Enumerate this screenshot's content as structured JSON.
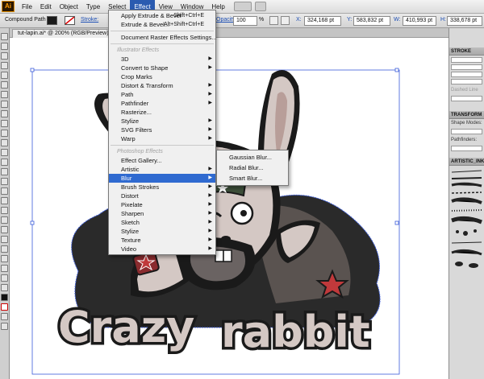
{
  "app": {
    "logo": "Ai"
  },
  "menubar": {
    "items": [
      "File",
      "Edit",
      "Object",
      "Type",
      "Select",
      "Effect",
      "View",
      "Window",
      "Help"
    ],
    "active": "Effect"
  },
  "controlbar": {
    "path_label": "Compound Path",
    "stroke_label": "Stroke:",
    "opacity_label": "Opacity:",
    "opacity_value": "100",
    "opacity_unit": "%",
    "x_label": "X:",
    "x_value": "324,168 pt",
    "y_label": "Y:",
    "y_value": "583,832 pt",
    "w_label": "W:",
    "w_value": "410,993 pt",
    "h_label": "H:",
    "h_value": "338,678 pt"
  },
  "document": {
    "tab_title": "tut-lapin.ai* @ 200% (RGB/Preview)",
    "close_glyph": "×"
  },
  "effect_menu": {
    "top_items": [
      {
        "label": "Apply Extrude & Bevel",
        "shortcut": "Shift+Ctrl+E"
      },
      {
        "label": "Extrude & Bevel...",
        "shortcut": "Alt+Shift+Ctrl+E"
      }
    ],
    "document_raster": "Document Raster Effects Settings...",
    "illustrator_header": "Illustrator Effects",
    "illustrator_items": [
      {
        "label": "3D",
        "submenu": true
      },
      {
        "label": "Convert to Shape",
        "submenu": true
      },
      {
        "label": "Crop Marks",
        "submenu": false
      },
      {
        "label": "Distort & Transform",
        "submenu": true
      },
      {
        "label": "Path",
        "submenu": true
      },
      {
        "label": "Pathfinder",
        "submenu": true
      },
      {
        "label": "Rasterize...",
        "submenu": false
      },
      {
        "label": "Stylize",
        "submenu": true
      },
      {
        "label": "SVG Filters",
        "submenu": true
      },
      {
        "label": "Warp",
        "submenu": true
      }
    ],
    "photoshop_header": "Photoshop Effects",
    "photoshop_items": [
      {
        "label": "Effect Gallery...",
        "submenu": false
      },
      {
        "label": "Artistic",
        "submenu": true
      },
      {
        "label": "Blur",
        "submenu": true,
        "highlighted": true
      },
      {
        "label": "Brush Strokes",
        "submenu": true
      },
      {
        "label": "Distort",
        "submenu": true
      },
      {
        "label": "Pixelate",
        "submenu": true
      },
      {
        "label": "Sharpen",
        "submenu": true
      },
      {
        "label": "Sketch",
        "submenu": true
      },
      {
        "label": "Stylize",
        "submenu": true
      },
      {
        "label": "Texture",
        "submenu": true
      },
      {
        "label": "Video",
        "submenu": true
      }
    ],
    "arrow_glyph": "▶"
  },
  "blur_submenu": {
    "items": [
      "Gaussian Blur...",
      "Radial Blur...",
      "Smart Blur..."
    ]
  },
  "panels": {
    "stroke": {
      "title": "STROKE",
      "dashed_line": "Dashed Line"
    },
    "transform": {
      "title": "TRANSFORM",
      "shape_modes": "Shape Modes:",
      "pathfinders": "Pathfinders:"
    },
    "artistic": {
      "title": "ARTISTIC_INK"
    }
  },
  "artwork": {
    "word1": "Crazy",
    "word2": "rabbit"
  },
  "colors": {
    "menu_highlight": "#2f6ad0",
    "selection_blue": "#3a5bd9",
    "rabbit_fur": "#d4c8c4",
    "outline": "#1a1a1a",
    "star_red": "#c0393b",
    "hat_green": "#3d4f3a"
  }
}
